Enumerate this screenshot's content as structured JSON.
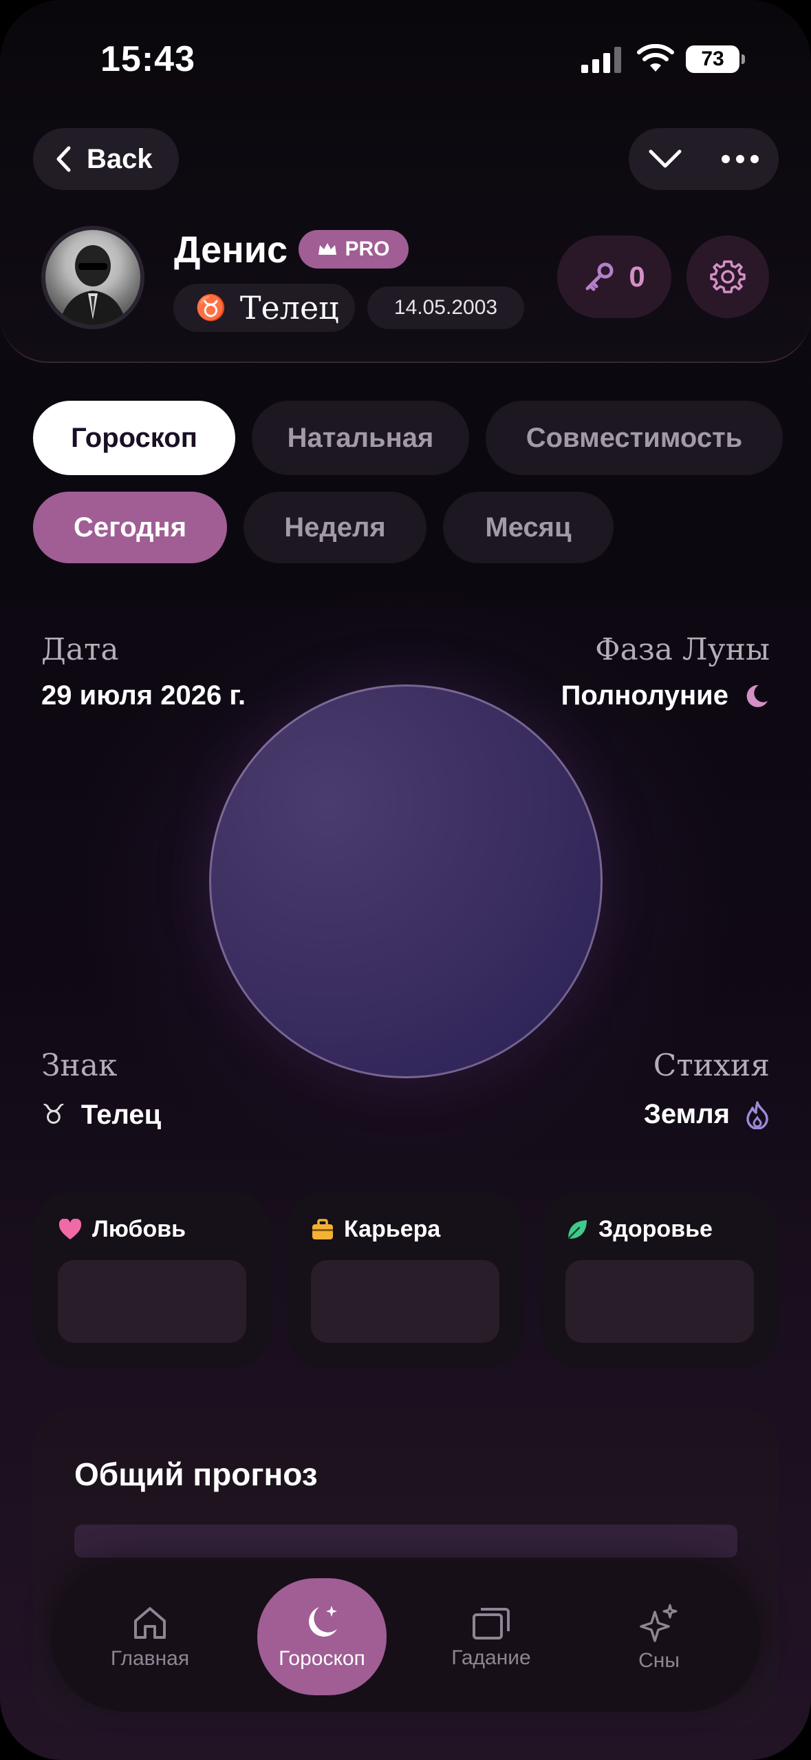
{
  "status_bar": {
    "time": "15:43",
    "battery": "73"
  },
  "nav": {
    "back_label": "Back"
  },
  "profile": {
    "name": "Денис",
    "pro_label": "PRO",
    "sign_symbol": "♉",
    "sign_name": "Телец",
    "birth_date": "14.05.2003",
    "keys_count": "0"
  },
  "tabs": [
    {
      "label": "Гороскоп",
      "active": true
    },
    {
      "label": "Натальная",
      "active": false
    },
    {
      "label": "Совместимость",
      "active": false
    }
  ],
  "periods": [
    {
      "label": "Сегодня",
      "active": true
    },
    {
      "label": "Неделя",
      "active": false
    },
    {
      "label": "Месяц",
      "active": false
    }
  ],
  "info": {
    "date_label": "Дата",
    "date_value": "29 июля 2026 г.",
    "moon_phase_label": "Фаза Луны",
    "moon_phase_value": "Полнолуние",
    "sign_label": "Знак",
    "sign_value": "Телец",
    "element_label": "Стихия",
    "element_value": "Земля"
  },
  "aspects": [
    {
      "label": "Любовь",
      "icon": "heart-icon",
      "color": "#f06aa8"
    },
    {
      "label": "Карьера",
      "icon": "briefcase-icon",
      "color": "#f2b233"
    },
    {
      "label": "Здоровье",
      "icon": "leaf-icon",
      "color": "#3fc98a"
    }
  ],
  "forecast": {
    "title": "Общий прогноз"
  },
  "tabbar": [
    {
      "label": "Главная",
      "icon": "home-icon"
    },
    {
      "label": "Гороскоп",
      "icon": "moon-stars-icon",
      "active": true
    },
    {
      "label": "Гадание",
      "icon": "cards-icon"
    },
    {
      "label": "Сны",
      "icon": "sparkles-icon"
    }
  ],
  "colors": {
    "accent": "#a05e94",
    "accent_light": "#d48fc6",
    "moon": "#3f3062"
  }
}
